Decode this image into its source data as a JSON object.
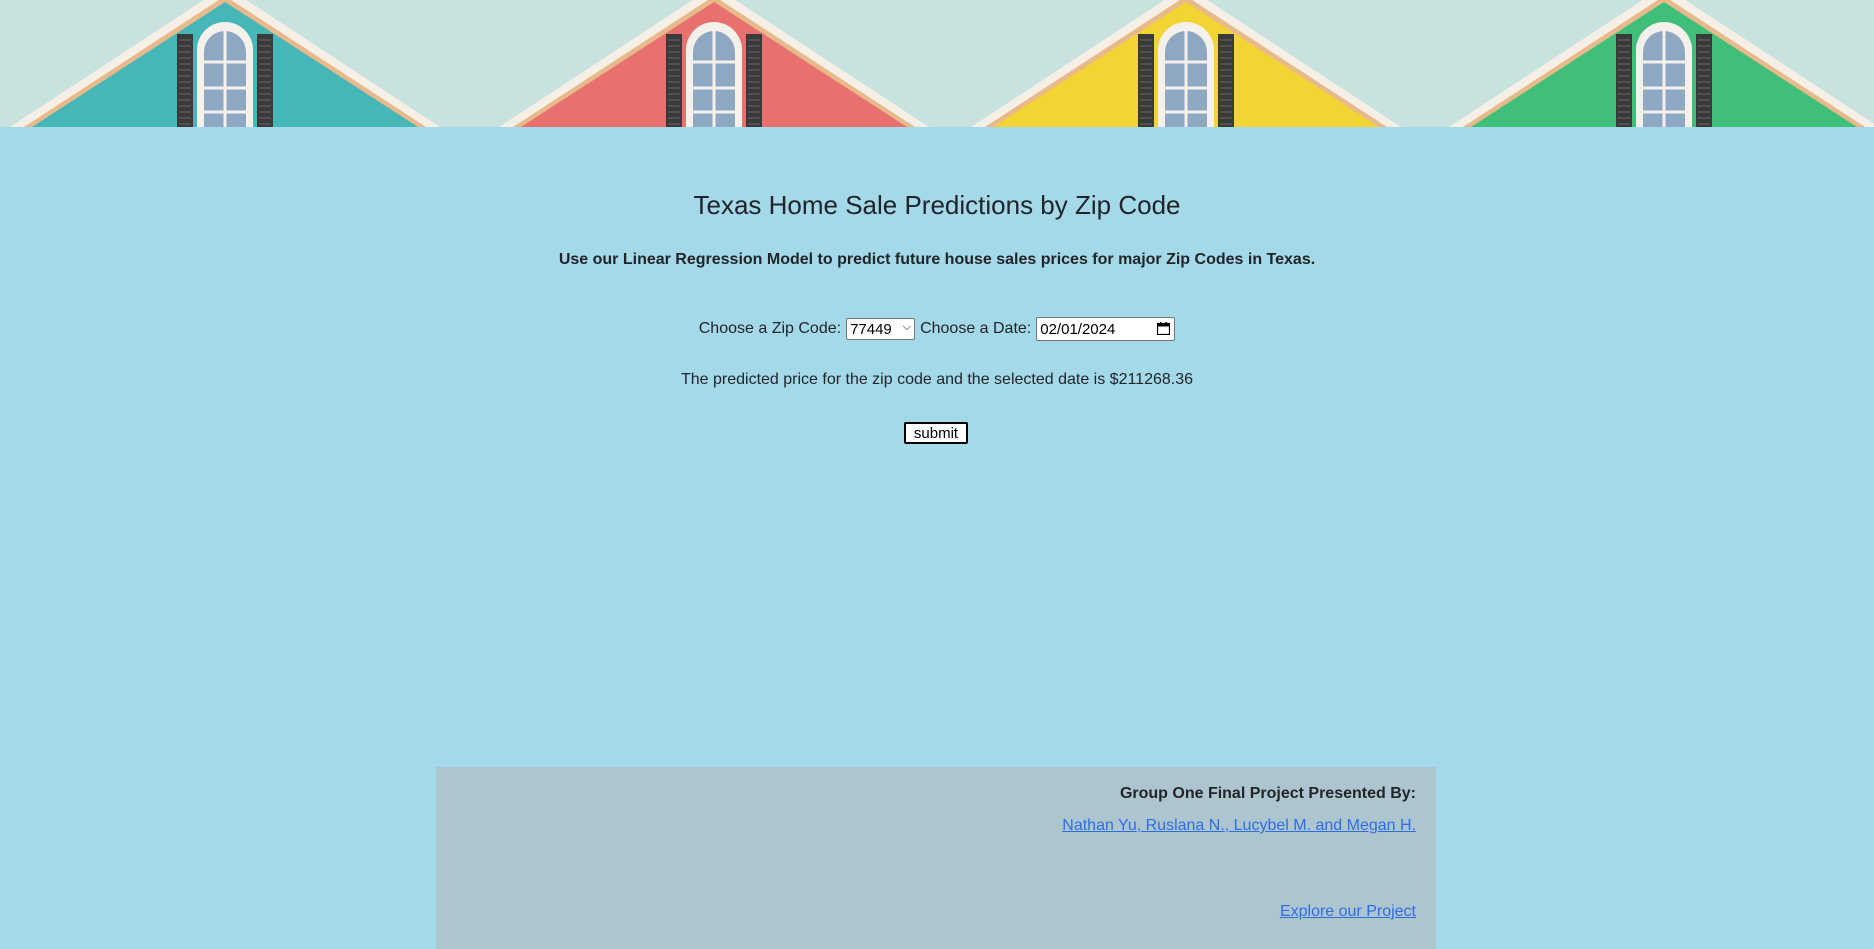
{
  "banner": {
    "houses": [
      {
        "color": "#45b7b8",
        "name": "teal-house"
      },
      {
        "color": "#e8706e",
        "name": "red-house"
      },
      {
        "color": "#f2d532",
        "name": "yellow-house"
      },
      {
        "color": "#3fbf79",
        "name": "green-house"
      }
    ],
    "sky_color": "#c7e2df"
  },
  "main": {
    "title": "Texas Home Sale Predictions by Zip Code",
    "subtitle": "Use our Linear Regression Model to predict future house sales prices for major Zip Codes in Texas.",
    "zip_label": "Choose a Zip Code:",
    "zip_value": "77449",
    "date_label": "Choose a Date:",
    "date_value": "02/01/2024",
    "prediction_text": "The predicted price for the zip code and the selected date is $211268.36",
    "submit_label": "submit"
  },
  "footer": {
    "heading": "Group One Final Project Presented By:",
    "names": [
      "Nathan Yu",
      "Ruslana N.",
      "Lucybel M.",
      "Megan H."
    ],
    "names_joiners": [
      ", ",
      ", ",
      " and ",
      ""
    ],
    "explore_label": "Explore our Project"
  },
  "colors": {
    "background": "#a3d9e9",
    "footer_bg": "#adc5ce",
    "link": "#2d6ee8"
  }
}
